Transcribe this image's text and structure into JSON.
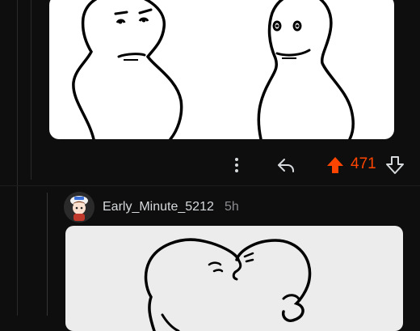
{
  "comment": {
    "actions": {
      "more_icon": "vertical-ellipsis-icon",
      "reply_icon": "reply-arrow-icon",
      "upvote_icon": "arrow-up-icon",
      "downvote_icon": "arrow-down-icon",
      "vote_count": "471",
      "vote_color": "#ff4500"
    }
  },
  "reply": {
    "username": "Early_Minute_5212",
    "timestamp": "5h"
  },
  "colors": {
    "background": "#0e0e0e",
    "text": "#d7dadc",
    "muted": "#8b8d90",
    "upvoted": "#ff4500"
  }
}
